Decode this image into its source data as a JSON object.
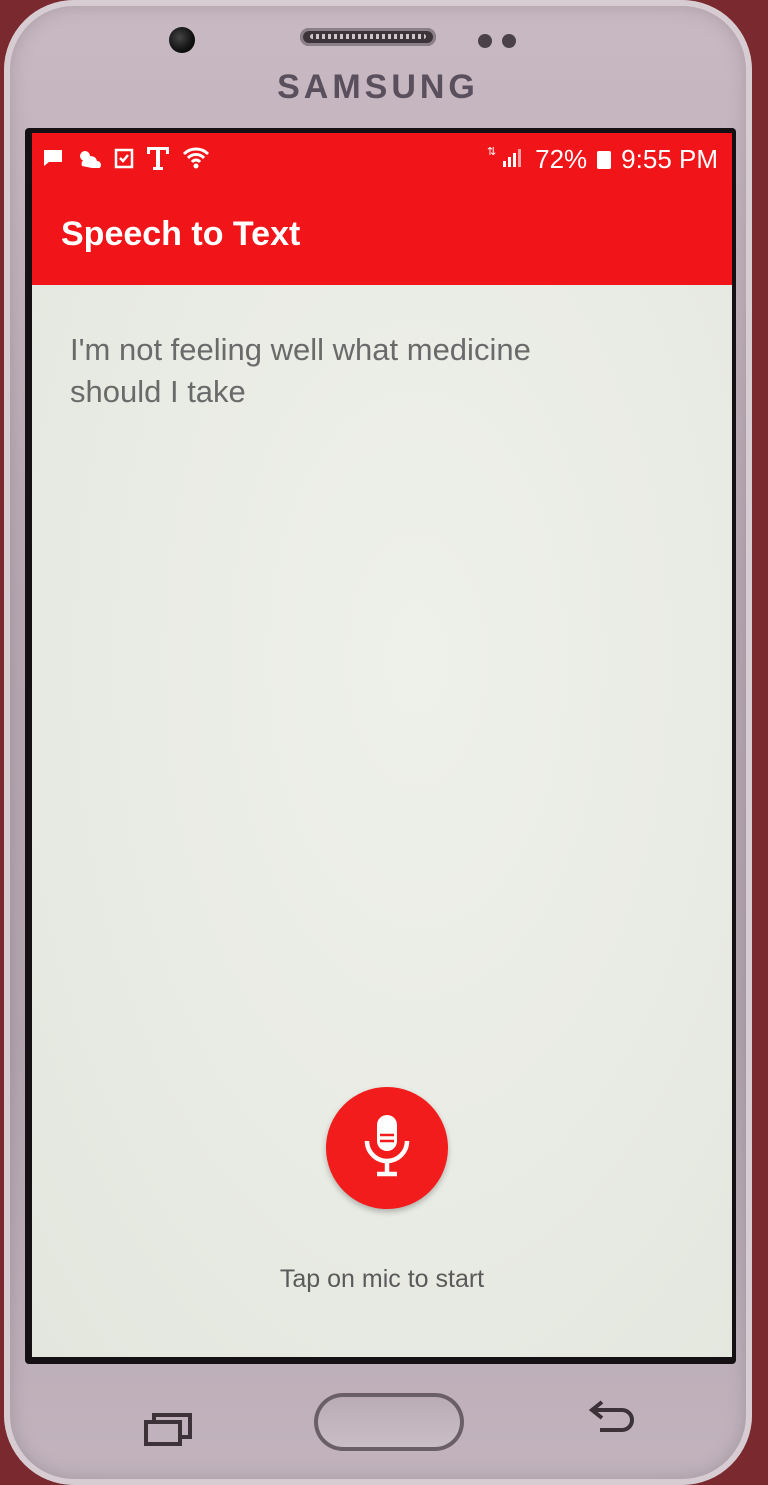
{
  "device": {
    "brand": "SAMSUNG"
  },
  "status_bar": {
    "battery": "72%",
    "time": "9:55 PM",
    "left_icons": [
      "message-icon",
      "weather-icon",
      "task-icon",
      "carrier-t-icon",
      "wifi-icon"
    ],
    "right_icons": [
      "signal-icon",
      "battery-icon"
    ]
  },
  "app_bar": {
    "title": "Speech to Text",
    "color": "#f11418"
  },
  "main": {
    "transcript": "I'm not feeling well what medicine should I take",
    "hint": "Tap on mic to start",
    "mic_color": "#f31c1c"
  }
}
